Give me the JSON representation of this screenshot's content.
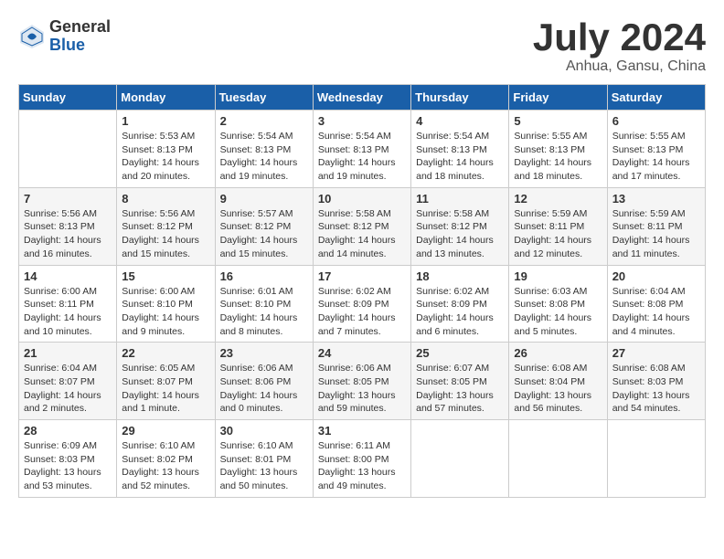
{
  "logo": {
    "general": "General",
    "blue": "Blue"
  },
  "title": {
    "month_year": "July 2024",
    "location": "Anhua, Gansu, China"
  },
  "headers": [
    "Sunday",
    "Monday",
    "Tuesday",
    "Wednesday",
    "Thursday",
    "Friday",
    "Saturday"
  ],
  "weeks": [
    [
      {
        "day": "",
        "info": ""
      },
      {
        "day": "1",
        "info": "Sunrise: 5:53 AM\nSunset: 8:13 PM\nDaylight: 14 hours\nand 20 minutes."
      },
      {
        "day": "2",
        "info": "Sunrise: 5:54 AM\nSunset: 8:13 PM\nDaylight: 14 hours\nand 19 minutes."
      },
      {
        "day": "3",
        "info": "Sunrise: 5:54 AM\nSunset: 8:13 PM\nDaylight: 14 hours\nand 19 minutes."
      },
      {
        "day": "4",
        "info": "Sunrise: 5:54 AM\nSunset: 8:13 PM\nDaylight: 14 hours\nand 18 minutes."
      },
      {
        "day": "5",
        "info": "Sunrise: 5:55 AM\nSunset: 8:13 PM\nDaylight: 14 hours\nand 18 minutes."
      },
      {
        "day": "6",
        "info": "Sunrise: 5:55 AM\nSunset: 8:13 PM\nDaylight: 14 hours\nand 17 minutes."
      }
    ],
    [
      {
        "day": "7",
        "info": "Sunrise: 5:56 AM\nSunset: 8:13 PM\nDaylight: 14 hours\nand 16 minutes."
      },
      {
        "day": "8",
        "info": "Sunrise: 5:56 AM\nSunset: 8:12 PM\nDaylight: 14 hours\nand 15 minutes."
      },
      {
        "day": "9",
        "info": "Sunrise: 5:57 AM\nSunset: 8:12 PM\nDaylight: 14 hours\nand 15 minutes."
      },
      {
        "day": "10",
        "info": "Sunrise: 5:58 AM\nSunset: 8:12 PM\nDaylight: 14 hours\nand 14 minutes."
      },
      {
        "day": "11",
        "info": "Sunrise: 5:58 AM\nSunset: 8:12 PM\nDaylight: 14 hours\nand 13 minutes."
      },
      {
        "day": "12",
        "info": "Sunrise: 5:59 AM\nSunset: 8:11 PM\nDaylight: 14 hours\nand 12 minutes."
      },
      {
        "day": "13",
        "info": "Sunrise: 5:59 AM\nSunset: 8:11 PM\nDaylight: 14 hours\nand 11 minutes."
      }
    ],
    [
      {
        "day": "14",
        "info": "Sunrise: 6:00 AM\nSunset: 8:11 PM\nDaylight: 14 hours\nand 10 minutes."
      },
      {
        "day": "15",
        "info": "Sunrise: 6:00 AM\nSunset: 8:10 PM\nDaylight: 14 hours\nand 9 minutes."
      },
      {
        "day": "16",
        "info": "Sunrise: 6:01 AM\nSunset: 8:10 PM\nDaylight: 14 hours\nand 8 minutes."
      },
      {
        "day": "17",
        "info": "Sunrise: 6:02 AM\nSunset: 8:09 PM\nDaylight: 14 hours\nand 7 minutes."
      },
      {
        "day": "18",
        "info": "Sunrise: 6:02 AM\nSunset: 8:09 PM\nDaylight: 14 hours\nand 6 minutes."
      },
      {
        "day": "19",
        "info": "Sunrise: 6:03 AM\nSunset: 8:08 PM\nDaylight: 14 hours\nand 5 minutes."
      },
      {
        "day": "20",
        "info": "Sunrise: 6:04 AM\nSunset: 8:08 PM\nDaylight: 14 hours\nand 4 minutes."
      }
    ],
    [
      {
        "day": "21",
        "info": "Sunrise: 6:04 AM\nSunset: 8:07 PM\nDaylight: 14 hours\nand 2 minutes."
      },
      {
        "day": "22",
        "info": "Sunrise: 6:05 AM\nSunset: 8:07 PM\nDaylight: 14 hours\nand 1 minute."
      },
      {
        "day": "23",
        "info": "Sunrise: 6:06 AM\nSunset: 8:06 PM\nDaylight: 14 hours\nand 0 minutes."
      },
      {
        "day": "24",
        "info": "Sunrise: 6:06 AM\nSunset: 8:05 PM\nDaylight: 13 hours\nand 59 minutes."
      },
      {
        "day": "25",
        "info": "Sunrise: 6:07 AM\nSunset: 8:05 PM\nDaylight: 13 hours\nand 57 minutes."
      },
      {
        "day": "26",
        "info": "Sunrise: 6:08 AM\nSunset: 8:04 PM\nDaylight: 13 hours\nand 56 minutes."
      },
      {
        "day": "27",
        "info": "Sunrise: 6:08 AM\nSunset: 8:03 PM\nDaylight: 13 hours\nand 54 minutes."
      }
    ],
    [
      {
        "day": "28",
        "info": "Sunrise: 6:09 AM\nSunset: 8:03 PM\nDaylight: 13 hours\nand 53 minutes."
      },
      {
        "day": "29",
        "info": "Sunrise: 6:10 AM\nSunset: 8:02 PM\nDaylight: 13 hours\nand 52 minutes."
      },
      {
        "day": "30",
        "info": "Sunrise: 6:10 AM\nSunset: 8:01 PM\nDaylight: 13 hours\nand 50 minutes."
      },
      {
        "day": "31",
        "info": "Sunrise: 6:11 AM\nSunset: 8:00 PM\nDaylight: 13 hours\nand 49 minutes."
      },
      {
        "day": "",
        "info": ""
      },
      {
        "day": "",
        "info": ""
      },
      {
        "day": "",
        "info": ""
      }
    ]
  ]
}
